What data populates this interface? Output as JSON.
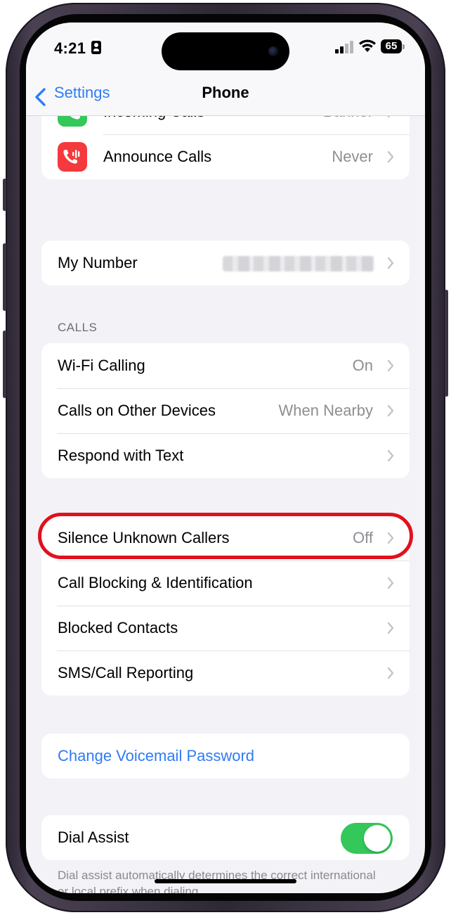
{
  "status_bar": {
    "time": "4:21",
    "battery": "65"
  },
  "nav": {
    "back_label": "Settings",
    "title": "Phone"
  },
  "group_top": [
    {
      "label": "Incoming Calls",
      "value": "Banner",
      "icon": "phone-icon",
      "icon_color": "#34c759"
    },
    {
      "label": "Announce Calls",
      "value": "Never",
      "icon": "announce-calls-icon",
      "icon_color": "#f43a3d"
    }
  ],
  "my_number": {
    "label": "My Number"
  },
  "calls_section": {
    "header": "CALLS",
    "rows": [
      {
        "label": "Wi-Fi Calling",
        "value": "On"
      },
      {
        "label": "Calls on Other Devices",
        "value": "When Nearby"
      },
      {
        "label": "Respond with Text",
        "value": ""
      }
    ]
  },
  "blocking_section": {
    "rows": [
      {
        "label": "Silence Unknown Callers",
        "value": "Off"
      },
      {
        "label": "Call Blocking & Identification",
        "value": ""
      },
      {
        "label": "Blocked Contacts",
        "value": ""
      },
      {
        "label": "SMS/Call Reporting",
        "value": ""
      }
    ]
  },
  "voicemail": {
    "label": "Change Voicemail Password"
  },
  "dial_assist": {
    "label": "Dial Assist",
    "enabled": true,
    "footer": "Dial assist automatically determines the correct international or local prefix when dialing."
  },
  "colors": {
    "accent": "#2f7bf6",
    "toggle_on": "#34c759",
    "highlight": "#e0111d"
  }
}
